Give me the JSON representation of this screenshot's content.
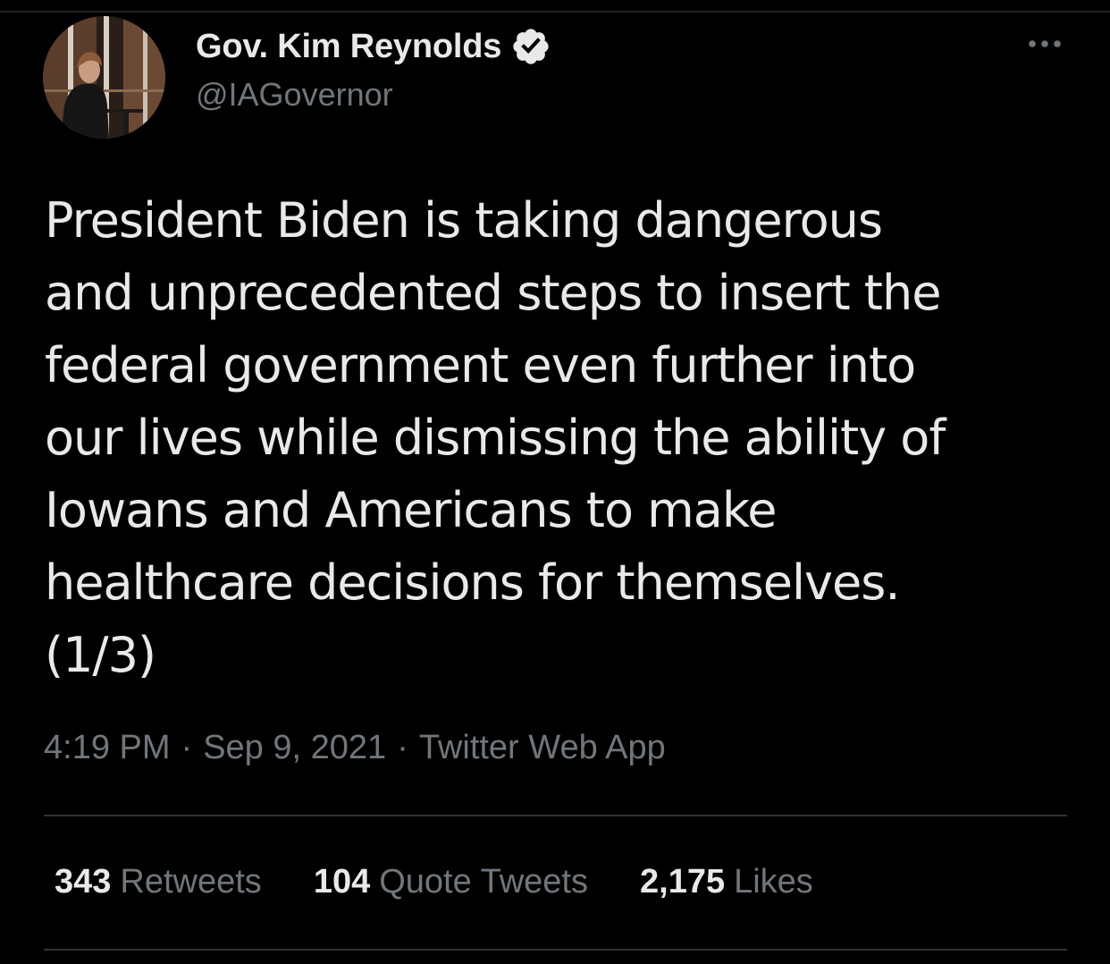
{
  "tweet": {
    "author": {
      "display_name": "Gov. Kim Reynolds",
      "handle": "@IAGovernor",
      "verified": true,
      "avatar_icon": "profile-photo"
    },
    "more_icon": "more-horizontal-icon",
    "text": "President Biden is taking dangerous\nand unprecedented steps to insert the\nfederal government even further into\nour lives while dismissing the ability of\nIowans and Americans to make\nhealthcare decisions for themselves.\n(1/3)",
    "time": "4:19 PM",
    "date": "Sep 9, 2021",
    "separator": "·",
    "source": "Twitter Web App",
    "stats": {
      "retweets": {
        "count": "343",
        "label": "Retweets"
      },
      "quote_tweets": {
        "count": "104",
        "label": "Quote Tweets"
      },
      "likes": {
        "count": "2,175",
        "label": "Likes"
      }
    }
  },
  "colors": {
    "background": "#000000",
    "primary_text": "#e7e9ea",
    "secondary_text": "#71767b",
    "divider": "#2f3336"
  }
}
